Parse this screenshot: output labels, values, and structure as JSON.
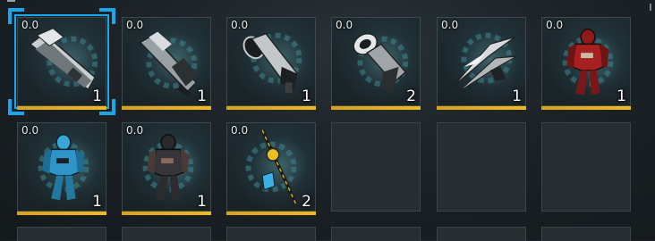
{
  "inventory": {
    "items": [
      {
        "rating": "0.0",
        "quantity": "1",
        "icon": "primary-rifle-icon",
        "selected": true
      },
      {
        "rating": "0.0",
        "quantity": "1",
        "icon": "shotgun-icon",
        "selected": false
      },
      {
        "rating": "0.0",
        "quantity": "1",
        "icon": "launcher-icon",
        "selected": false
      },
      {
        "rating": "0.0",
        "quantity": "2",
        "icon": "cannon-icon",
        "selected": false
      },
      {
        "rating": "0.0",
        "quantity": "1",
        "icon": "blade-weapon-icon",
        "selected": false
      },
      {
        "rating": "0.0",
        "quantity": "1",
        "icon": "red-warframe-icon",
        "selected": false
      },
      {
        "rating": "0.0",
        "quantity": "1",
        "icon": "blue-warframe-icon",
        "selected": false
      },
      {
        "rating": "0.0",
        "quantity": "1",
        "icon": "dark-warframe-icon",
        "selected": false
      },
      {
        "rating": "0.0",
        "quantity": "2",
        "icon": "golden-staff-icon",
        "selected": false
      }
    ],
    "colors": {
      "selection": "#1aa6ef",
      "rarity_bar": "#f0b91e",
      "empty_slot": "#272e32"
    }
  }
}
